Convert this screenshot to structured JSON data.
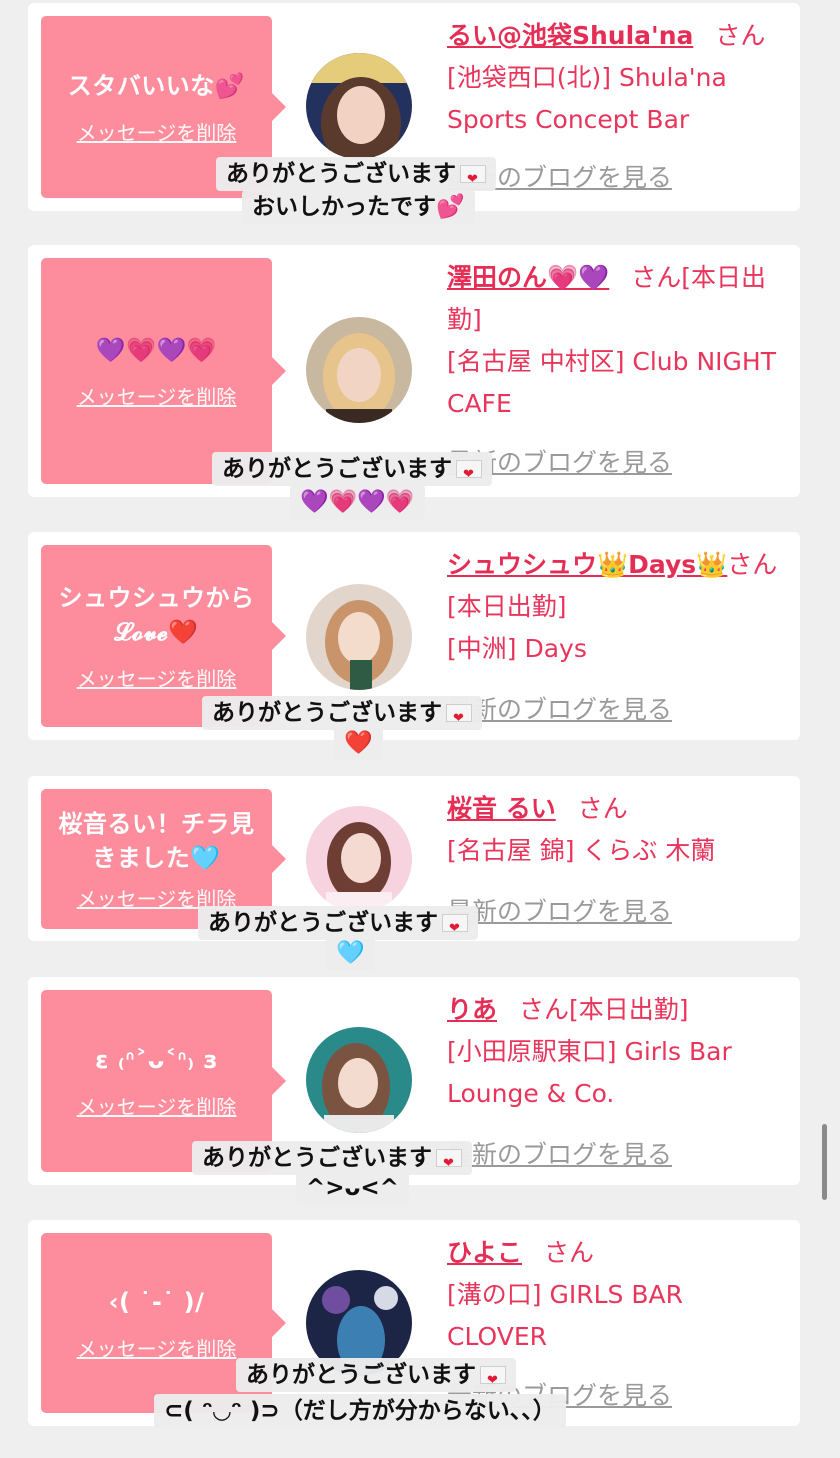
{
  "delete_label": "メッセージを削除",
  "blog_label": "最新のブログを見る",
  "san_label": "さん",
  "cards": [
    {
      "bubble_text": "スタバいいな💕",
      "name": "るい@池袋Shula'na",
      "status": "",
      "shop": "[池袋西口(北)] Shula'na Sports Concept Bar",
      "caption_line1": "ありがとうございます",
      "caption_line2": "おいしかったです💕"
    },
    {
      "bubble_text": "💜💗💜💗",
      "name": "澤田のん💗💜",
      "status": "[本日出勤]",
      "shop": "[名古屋 中村区] Club NIGHT CAFE",
      "caption_line1": "ありがとうございます",
      "caption_line2": "💜💗💜💗"
    },
    {
      "bubble_text": "シュウシュウから 𝓛𝓸𝓿𝓮❤️",
      "name": "シュウシュウ👑Days👑",
      "status": "[本日出勤]",
      "shop": "[中洲] Days",
      "caption_line1": "ありがとうございます",
      "caption_line2": "❤️"
    },
    {
      "bubble_text": "桜音るい！チラ見きました🩵",
      "name": "桜音 るい",
      "status": "",
      "shop": "[名古屋 錦] くらぶ 木蘭",
      "caption_line1": "ありがとうございます",
      "caption_line2": "🩵"
    },
    {
      "bubble_text": "ε ₍ᐢ˃ᴗ˂ᐢ₎ з",
      "name": "りあ",
      "status": "[本日出勤]",
      "shop": "[小田原駅東口] Girls Bar Lounge & Co.",
      "caption_line1": "ありがとうございます",
      "caption_line2": "^>ᴗ<^"
    },
    {
      "bubble_text": "‹(  ˙-˙ )/",
      "name": "ひよこ",
      "status": "",
      "shop": "[溝の口] GIRLS BAR CLOVER",
      "caption_line1": "ありがとうございます",
      "caption_line2": "⊂( ᵔ◡ᵔ )⊃（だし方が分からない、、）"
    }
  ],
  "colors": {
    "background": "#efefef",
    "bubble": "#fd8d9c",
    "name": "#e52e55",
    "link_gray": "#9a9a9a"
  }
}
